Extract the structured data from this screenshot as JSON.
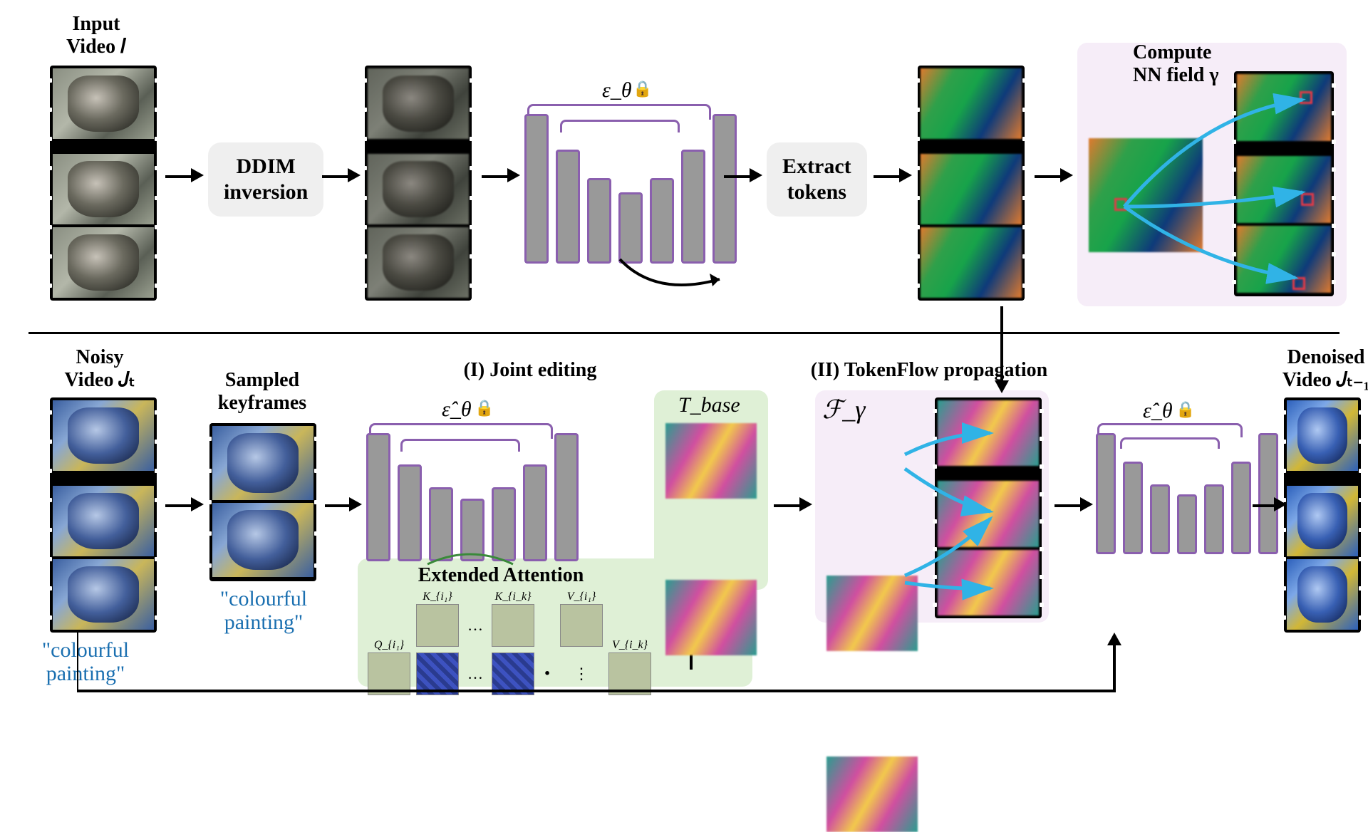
{
  "top": {
    "input_label_l1": "Input",
    "input_label_l2": "Video 𝐼",
    "ddim_label": "DDIM\ninversion",
    "unet_symbol": "ε_θ",
    "unet_locked": true,
    "extract_label": "Extract\ntokens",
    "nn_label_l1": "Compute",
    "nn_label_l2": "NN field γ",
    "strip_frames": [
      "wolf1",
      "wolf2",
      "wolf3"
    ],
    "token_frames": [
      "tok1",
      "tok2",
      "tok3"
    ]
  },
  "bottom": {
    "noisy_label_l1": "Noisy",
    "noisy_label_l2": "Video 𝐽ₜ",
    "keyframes_label_l1": "Sampled",
    "keyframes_label_l2": "keyframes",
    "prompt_text": "\"colourful\npainting\"",
    "joint_label": "(I) Joint editing",
    "unet_edit_symbol": "ε̂_θ",
    "unet_edit_locked": true,
    "ext_attn_label": "Extended Attention",
    "attn_Q": "Q_{i₁}",
    "attn_K1": "K_{i₁}",
    "attn_Kk": "K_{i_k}",
    "attn_V1": "V_{i₁}",
    "attn_Vk": "V_{i_k}",
    "tbase_label": "T_base",
    "token_prop_label": "(II) TokenFlow propagation",
    "flow_symbol": "ℱ_γ",
    "unet_out_symbol": "ε̂_θ",
    "unet_out_locked": true,
    "denoised_label_l1": "Denoised",
    "denoised_label_l2": "Video 𝐽ₜ₋₁"
  },
  "diagram": {
    "stages_top": [
      "Input video I",
      "DDIM inversion",
      "Noised frames",
      "Noise predictor ε_θ (frozen U-Net)",
      "Extract tokens",
      "Per-frame token features",
      "Compute NN field γ"
    ],
    "stages_bottom": [
      "Noisy video J_t + text prompt",
      "Sample keyframes",
      "Joint editing via Extended Attention (Q_{i1}·[K_{i1}…K_{ik}]·[V_{i1}…V_{ik}]) → T_base",
      "TokenFlow propagation using ℱ_γ",
      "Second ε̂_θ pass",
      "Denoised video J_{t-1}"
    ],
    "frozen_symbol": "🔒",
    "nn_arrow_color": "#30b3e6"
  }
}
